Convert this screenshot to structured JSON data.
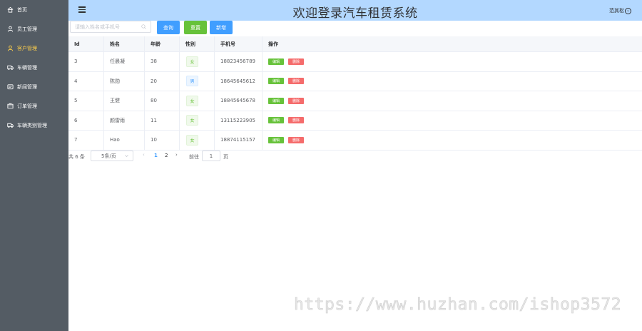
{
  "sidebar": {
    "items": [
      {
        "label": "首页",
        "icon": "home-icon",
        "active": false
      },
      {
        "label": "员工管理",
        "icon": "user-icon",
        "active": false
      },
      {
        "label": "客户管理",
        "icon": "user-icon",
        "active": true
      },
      {
        "label": "车辆管理",
        "icon": "truck-icon",
        "active": false
      },
      {
        "label": "新闻管理",
        "icon": "news-icon",
        "active": false
      },
      {
        "label": "订单管理",
        "icon": "order-icon",
        "active": false
      },
      {
        "label": "车辆类别管理",
        "icon": "truck-icon",
        "active": false
      }
    ],
    "background": "#545c64",
    "active_color": "#ffd04b"
  },
  "header": {
    "title": "欢迎登录汽车租赁系统",
    "user": "范其松",
    "background": "#b3d8ff"
  },
  "toolbar": {
    "search_placeholder": "请输入姓名或手机号",
    "query_label": "查询",
    "reset_label": "重置",
    "add_label": "新增"
  },
  "table": {
    "headers": {
      "id": "Id",
      "name": "姓名",
      "age": "年龄",
      "gender": "性别",
      "phone": "手机号",
      "op": "操作"
    },
    "rows": [
      {
        "id": "3",
        "name": "任晨凝",
        "age": "38",
        "gender": "女",
        "gender_type": "f",
        "phone": "18823456789"
      },
      {
        "id": "4",
        "name": "陈勋",
        "age": "20",
        "gender": "男",
        "gender_type": "m",
        "phone": "18645645612"
      },
      {
        "id": "5",
        "name": "王健",
        "age": "80",
        "gender": "女",
        "gender_type": "f",
        "phone": "18845645678"
      },
      {
        "id": "6",
        "name": "颜雷雨",
        "age": "11",
        "gender": "女",
        "gender_type": "f",
        "phone": "13115223905"
      },
      {
        "id": "7",
        "name": "Hao",
        "age": "10",
        "gender": "女",
        "gender_type": "f",
        "phone": "18874115157"
      }
    ],
    "edit_label": "编辑",
    "delete_label": "删除"
  },
  "pagination": {
    "total_text": "共 6 条",
    "page_size": "5条/页",
    "prev": "‹",
    "next": "›",
    "pages": [
      "1",
      "2"
    ],
    "current_page": "1",
    "goto_label": "前往",
    "goto_value": "1",
    "page_unit": "页"
  },
  "watermark": "https://www.huzhan.com/ishop3572"
}
